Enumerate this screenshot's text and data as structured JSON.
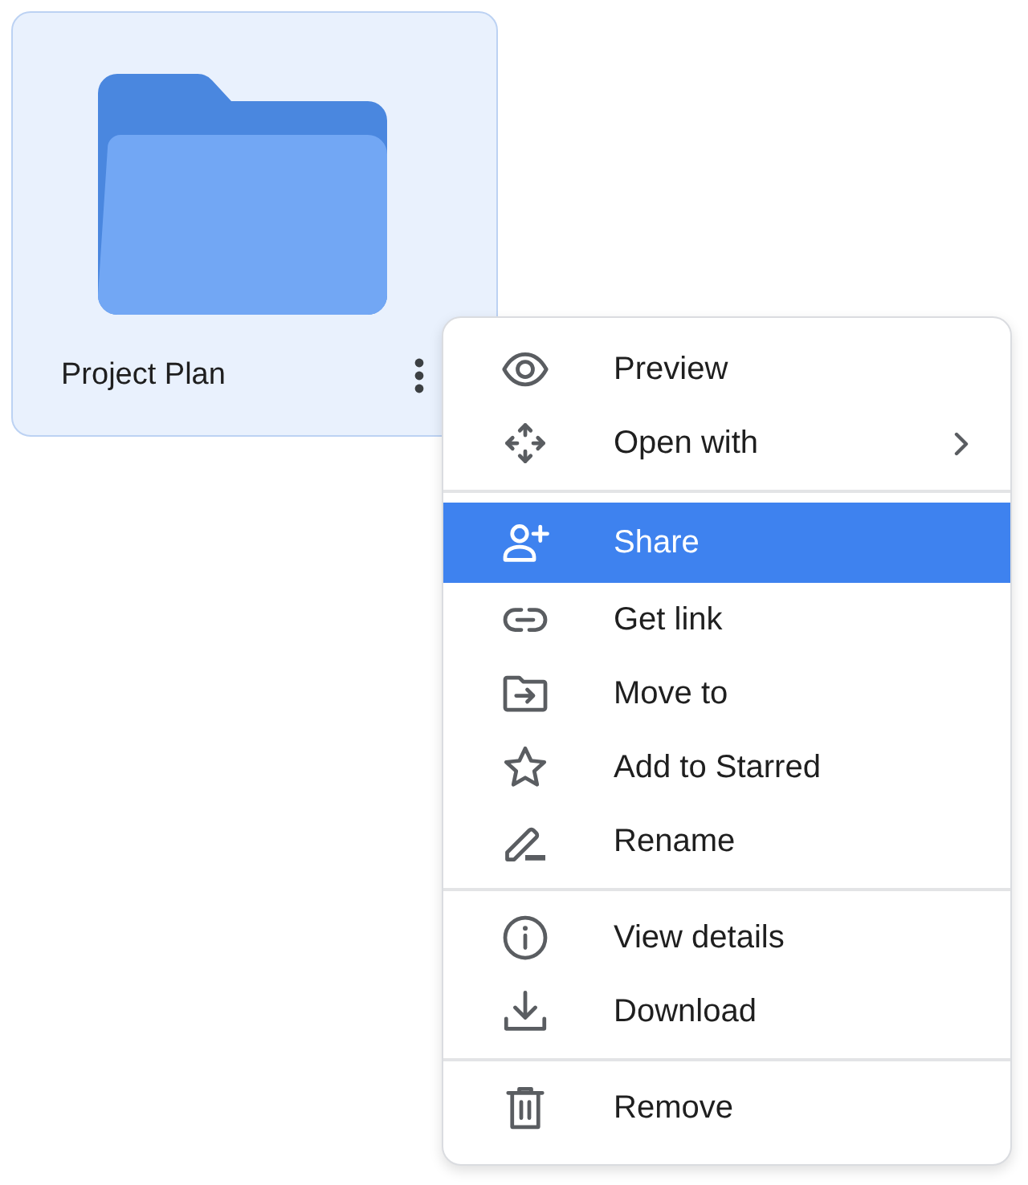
{
  "file_card": {
    "name": "Project Plan",
    "selected": true
  },
  "context_menu": {
    "sections": [
      {
        "items": [
          {
            "label": "Preview",
            "selected": false,
            "submenu": false
          },
          {
            "label": "Open with",
            "selected": false,
            "submenu": true
          }
        ]
      },
      {
        "items": [
          {
            "label": "Share",
            "selected": true,
            "submenu": false
          },
          {
            "label": "Get link",
            "selected": false,
            "submenu": false
          },
          {
            "label": "Move to",
            "selected": false,
            "submenu": false
          },
          {
            "label": "Add to Starred",
            "selected": false,
            "submenu": false
          },
          {
            "label": "Rename",
            "selected": false,
            "submenu": false
          }
        ]
      },
      {
        "items": [
          {
            "label": "View details",
            "selected": false,
            "submenu": false
          },
          {
            "label": "Download",
            "selected": false,
            "submenu": false
          }
        ]
      },
      {
        "items": [
          {
            "label": "Remove",
            "selected": false,
            "submenu": false
          }
        ]
      }
    ]
  }
}
